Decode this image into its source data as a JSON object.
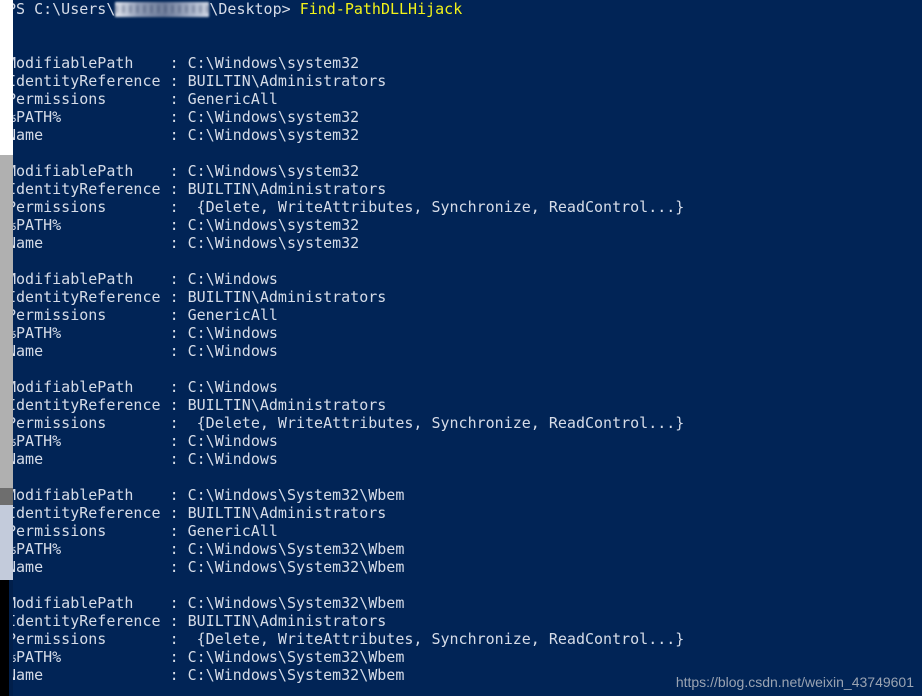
{
  "terminal": {
    "background_color": "#012456",
    "text_color": "#d6dce8",
    "command_color": "#f3f318",
    "prompt_prefix": "PS C:\\Users\\",
    "prompt_suffix": "\\Desktop> ",
    "command": "Find-PathDLLHijack",
    "redacted_username_note": "blurred"
  },
  "field_labels": {
    "modifiable_path": "ModifiablePath",
    "identity_reference": "IdentityReference",
    "permissions": "Permissions",
    "path_var": "%PATH%",
    "name": "Name"
  },
  "separator": ":",
  "records": [
    {
      "ModifiablePath": "C:\\Windows\\system32",
      "IdentityReference": "BUILTIN\\Administrators",
      "Permissions": "GenericAll",
      "Permissions_indent": false,
      "%PATH%": "C:\\Windows\\system32",
      "Name": "C:\\Windows\\system32"
    },
    {
      "ModifiablePath": "C:\\Windows\\system32",
      "IdentityReference": "BUILTIN\\Administrators",
      "Permissions": "{Delete, WriteAttributes, Synchronize, ReadControl...}",
      "Permissions_indent": true,
      "%PATH%": "C:\\Windows\\system32",
      "Name": "C:\\Windows\\system32"
    },
    {
      "ModifiablePath": "C:\\Windows",
      "IdentityReference": "BUILTIN\\Administrators",
      "Permissions": "GenericAll",
      "Permissions_indent": false,
      "%PATH%": "C:\\Windows",
      "Name": "C:\\Windows"
    },
    {
      "ModifiablePath": "C:\\Windows",
      "IdentityReference": "BUILTIN\\Administrators",
      "Permissions": "{Delete, WriteAttributes, Synchronize, ReadControl...}",
      "Permissions_indent": true,
      "%PATH%": "C:\\Windows",
      "Name": "C:\\Windows"
    },
    {
      "ModifiablePath": "C:\\Windows\\System32\\Wbem",
      "IdentityReference": "BUILTIN\\Administrators",
      "Permissions": "GenericAll",
      "Permissions_indent": false,
      "%PATH%": "C:\\Windows\\System32\\Wbem",
      "Name": "C:\\Windows\\System32\\Wbem"
    },
    {
      "ModifiablePath": "C:\\Windows\\System32\\Wbem",
      "IdentityReference": "BUILTIN\\Administrators",
      "Permissions": "{Delete, WriteAttributes, Synchronize, ReadControl...}",
      "Permissions_indent": true,
      "%PATH%": "C:\\Windows\\System32\\Wbem",
      "Name": "C:\\Windows\\System32\\Wbem"
    }
  ],
  "watermark": {
    "text": "https://blog.csdn.net/weixin_43749601",
    "color": "#9aa3b2"
  },
  "scrollbar": {
    "track_color": "#ffffff",
    "thumb_color": "#b0b0b0",
    "dark_segment_color": "#6e6e6e",
    "light_segment_color": "#c3cbdb",
    "bottom_color": "#000000"
  }
}
